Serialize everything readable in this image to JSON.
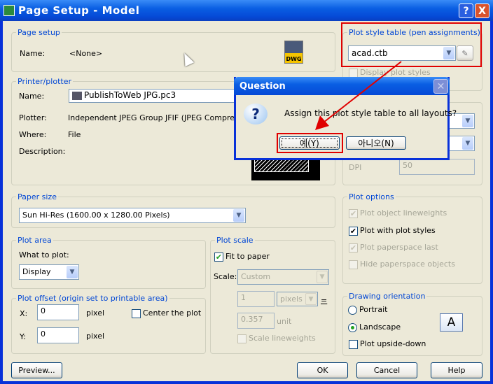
{
  "window": {
    "title": "Page Setup - Model",
    "help": "?",
    "close": "X"
  },
  "page_setup": {
    "label": "Page setup",
    "name_label": "Name:",
    "name_value": "<None>",
    "dwg_icon": "DWG"
  },
  "printer": {
    "label": "Printer/plotter",
    "name_label": "Name:",
    "name_value": "PublishToWeb JPG.pc3",
    "plotter_label": "Plotter:",
    "plotter_value": "Independent JPEG Group JFIF (JPEG Compression)",
    "where_label": "Where:",
    "where_value": "File",
    "description_label": "Description:"
  },
  "plot_style": {
    "label": "Plot style table (pen assignments)",
    "value": "acad.ctb",
    "display_label": "Display plot styles"
  },
  "shaded": {
    "dpi_label": "DPI",
    "dpi_value": "50"
  },
  "paper_size": {
    "label": "Paper size",
    "value": "Sun Hi-Res (1600.00 x 1280.00 Pixels)"
  },
  "plot_area": {
    "label": "Plot area",
    "what_label": "What to plot:",
    "what_value": "Display"
  },
  "plot_offset": {
    "label": "Plot offset (origin set to printable area)",
    "x_label": "X:",
    "x_value": "0",
    "x_unit": "pixel",
    "y_label": "Y:",
    "y_value": "0",
    "y_unit": "pixel",
    "center_label": "Center the plot",
    "center_checked": false
  },
  "plot_scale": {
    "label": "Plot scale",
    "fit_label": "Fit to paper",
    "fit_checked": true,
    "scale_label": "Scale:",
    "scale_value": "Custom",
    "val1": "1",
    "unit1": "pixels",
    "equals": "=",
    "val2": "0.357",
    "unit2": "unit",
    "lineweights_label": "Scale lineweights"
  },
  "plot_options": {
    "label": "Plot options",
    "items": [
      {
        "label": "Plot object lineweights",
        "checked": true,
        "enabled": false
      },
      {
        "label": "Plot with plot styles",
        "checked": true,
        "enabled": true
      },
      {
        "label": "Plot paperspace last",
        "checked": true,
        "enabled": false
      },
      {
        "label": "Hide paperspace objects",
        "checked": false,
        "enabled": false
      }
    ]
  },
  "orientation": {
    "label": "Drawing orientation",
    "portrait": "Portrait",
    "landscape": "Landscape",
    "selected": "Landscape",
    "upside_down": "Plot upside-down",
    "icon": "A"
  },
  "buttons": {
    "preview": "Preview...",
    "ok": "OK",
    "cancel": "Cancel",
    "help": "Help"
  },
  "question": {
    "title": "Question",
    "message": "Assign this plot style table to all layouts?",
    "yes": "예(Y)",
    "no": "아니오(N)"
  },
  "colors": {
    "highlight": "#e00000",
    "group_label": "#0046d5",
    "title_bar": "#0a5fe3"
  }
}
